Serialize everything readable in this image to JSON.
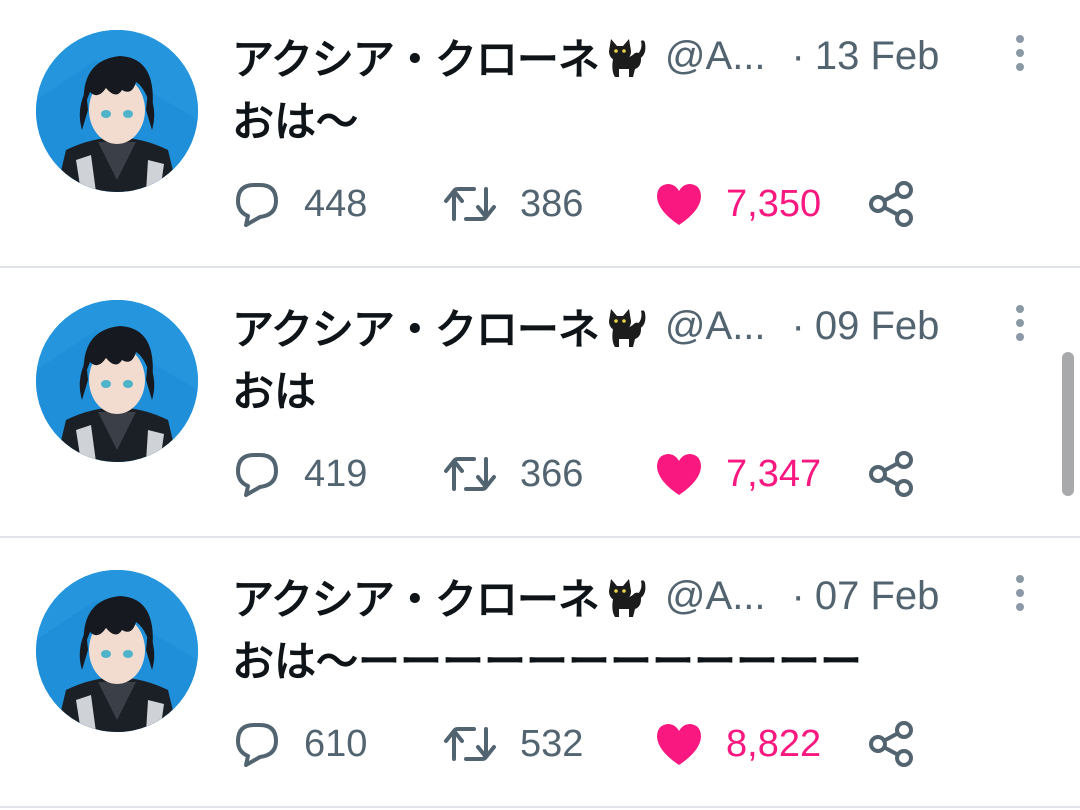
{
  "colors": {
    "text_primary": "#0f1419",
    "text_secondary": "#536471",
    "like_active": "#f91880",
    "divider": "#e1e5e9",
    "avatar_bg": "#1e8fd8"
  },
  "icons": {
    "name_emoji": "black-cat-icon",
    "more": "more-vertical-icon",
    "reply": "speech-bubble-icon",
    "retweet": "retweet-icon",
    "like": "heart-filled-icon",
    "share": "share-icon"
  },
  "tweets": [
    {
      "display_name": "アクシア・クローネ",
      "handle": "@A...",
      "dot": "·",
      "date": "13 Feb",
      "text": "おは〜",
      "replies": "448",
      "retweets": "386",
      "likes": "7,350",
      "liked": true
    },
    {
      "display_name": "アクシア・クローネ",
      "handle": "@A...",
      "dot": "·",
      "date": "09 Feb",
      "text": "おは",
      "replies": "419",
      "retweets": "366",
      "likes": "7,347",
      "liked": true
    },
    {
      "display_name": "アクシア・クローネ",
      "handle": "@A...",
      "dot": "·",
      "date": "07 Feb",
      "text": "おは〜ーーーーーーーーーーーー",
      "replies": "610",
      "retweets": "532",
      "likes": "8,822",
      "liked": true
    }
  ]
}
